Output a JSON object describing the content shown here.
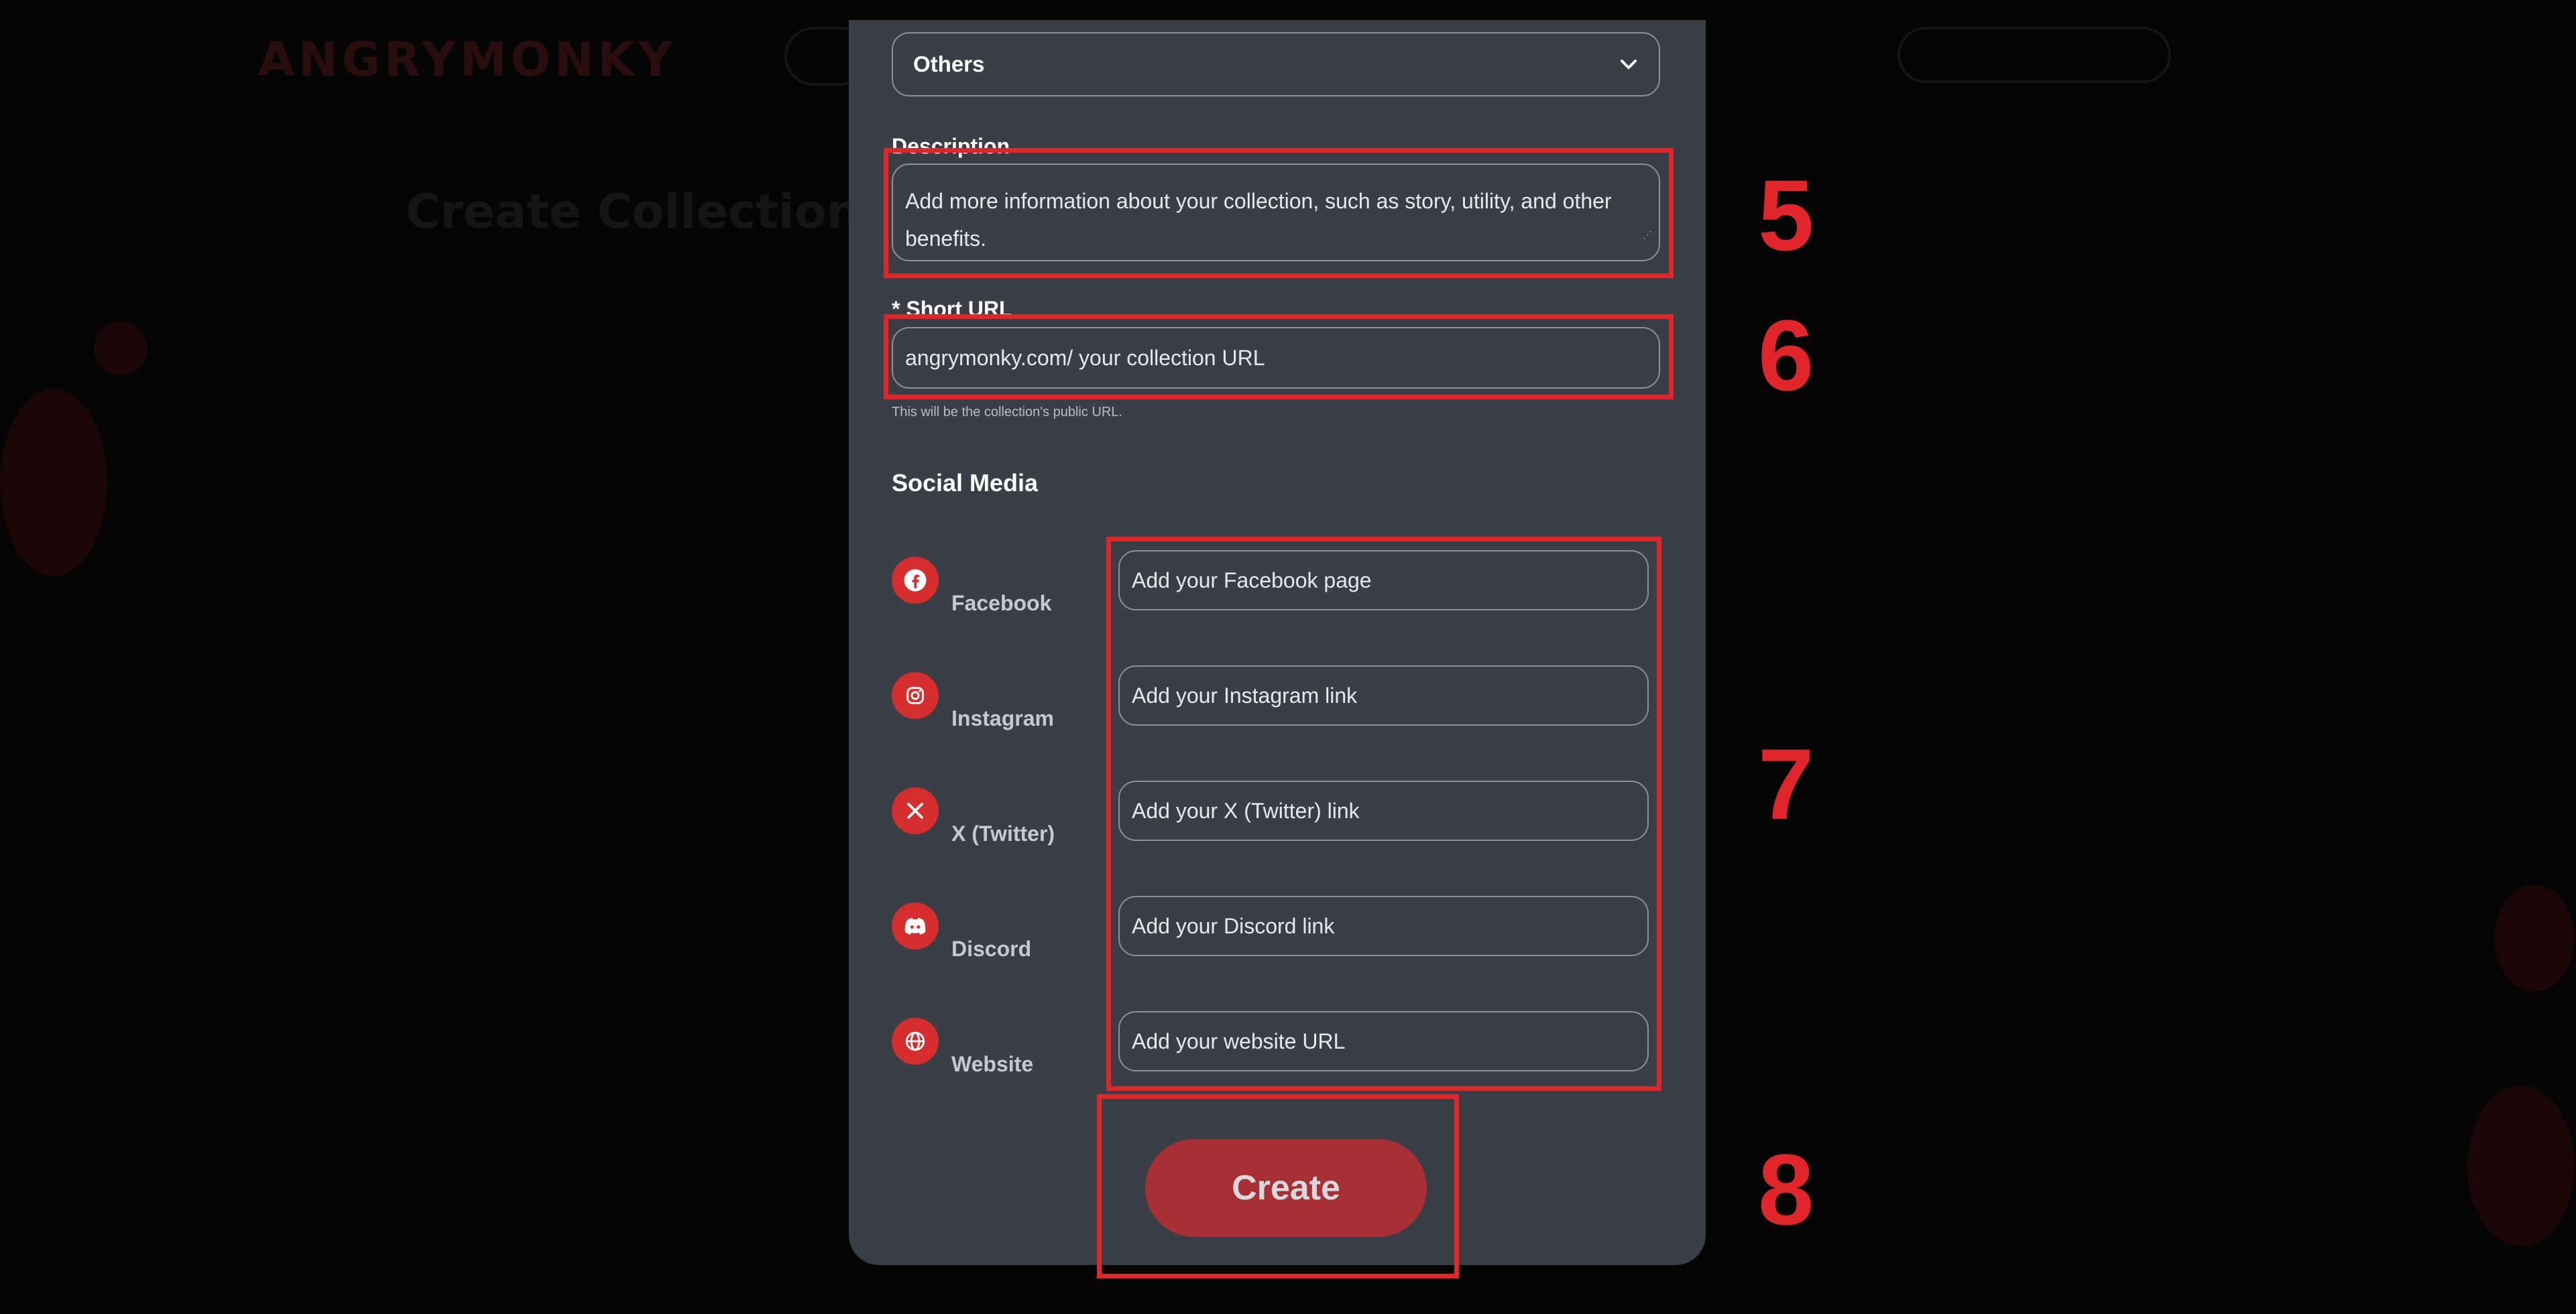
{
  "modal": {
    "category_value": "Others",
    "description_label": "Description",
    "description_placeholder": "Add more information about your collection, such as story, utility, and other benefits.",
    "short_url_label": "* Short URL",
    "short_url_placeholder": "angrymonky.com/ your collection URL",
    "short_url_helper": "This will be the collection's public URL.",
    "social_title": "Social Media",
    "social": [
      {
        "label": "Facebook",
        "placeholder": "Add your Facebook page",
        "icon": "facebook-icon"
      },
      {
        "label": "Instagram",
        "placeholder": "Add your Instagram link",
        "icon": "instagram-icon"
      },
      {
        "label": "X (Twitter)",
        "placeholder": "Add your X (Twitter) link",
        "icon": "x-twitter-icon"
      },
      {
        "label": "Discord",
        "placeholder": "Add your Discord link",
        "icon": "discord-icon"
      },
      {
        "label": "Website",
        "placeholder": "Add your website URL",
        "icon": "globe-icon"
      }
    ],
    "create_label": "Create"
  },
  "annotations": [
    "5",
    "6",
    "7",
    "8"
  ],
  "colors": {
    "accent": "#d62e2e",
    "annotation": "#e0262b",
    "modal_bg": "#3a3f47"
  }
}
